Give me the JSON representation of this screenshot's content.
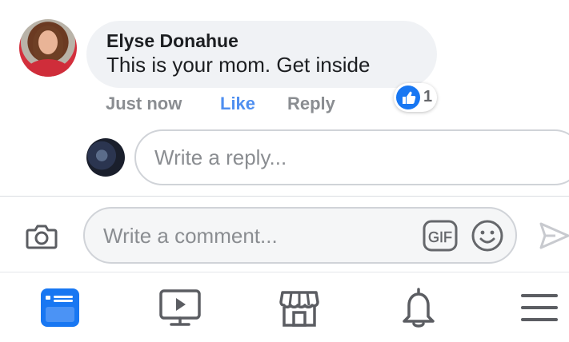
{
  "comment": {
    "author": "Elyse Donahue",
    "text": "This is your mom. Get inside",
    "time": "Just now",
    "like_label": "Like",
    "reply_label": "Reply",
    "reaction_count": "1",
    "reaction_icon": "like-thumb-icon"
  },
  "reply_box": {
    "placeholder": "Write a reply..."
  },
  "composer": {
    "placeholder": "Write a comment...",
    "gif_label": "GIF",
    "icons": [
      "camera-icon",
      "gif-icon",
      "emoji-icon",
      "send-icon"
    ]
  },
  "bottom_nav": {
    "items": [
      "news-feed-icon",
      "watch-icon",
      "marketplace-icon",
      "notifications-icon",
      "menu-icon"
    ],
    "active": "news-feed-icon"
  },
  "colors": {
    "accent": "#1877f2",
    "like_text": "#4f8ff0",
    "muted": "#8a8d91",
    "icon_gray": "#5b5d62"
  }
}
